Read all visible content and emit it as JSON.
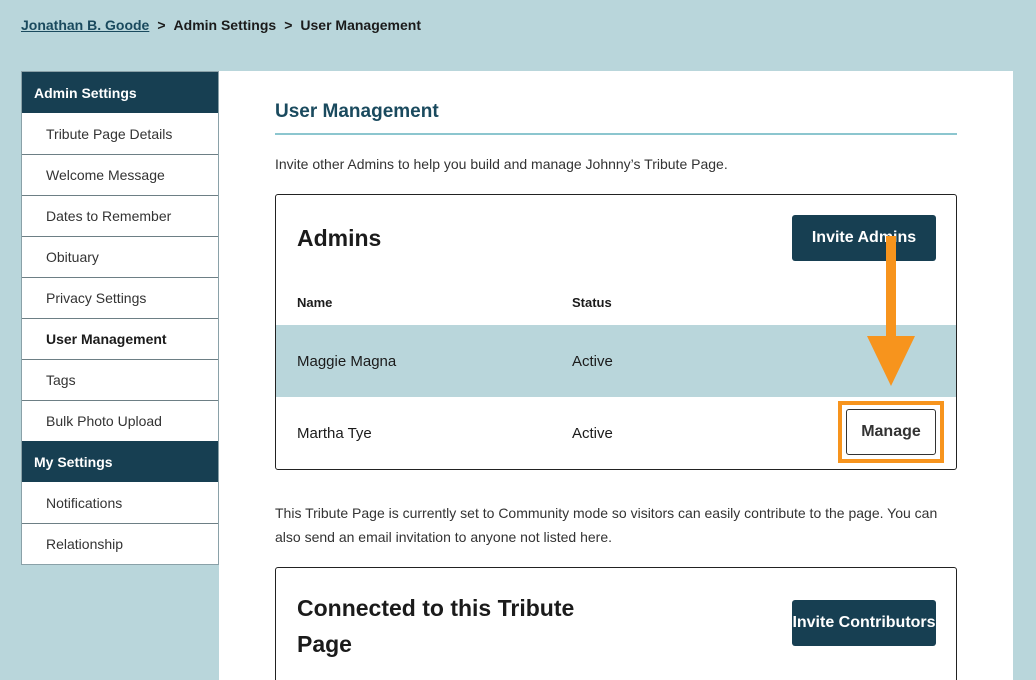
{
  "breadcrumb": {
    "user": "Jonathan B. Goode",
    "sep1": ">",
    "section": "Admin Settings",
    "sep2": ">",
    "current": "User Management"
  },
  "sidebar": {
    "admin_header": "Admin Settings",
    "admin_items": [
      {
        "label": "Tribute Page Details"
      },
      {
        "label": "Welcome Message"
      },
      {
        "label": "Dates to Remember"
      },
      {
        "label": "Obituary"
      },
      {
        "label": "Privacy Settings"
      },
      {
        "label": "User Management"
      },
      {
        "label": "Tags"
      },
      {
        "label": "Bulk Photo Upload"
      }
    ],
    "my_header": "My Settings",
    "my_items": [
      {
        "label": "Notifications"
      },
      {
        "label": "Relationship"
      }
    ]
  },
  "main": {
    "title": "User Management",
    "intro": "Invite other Admins to help you build and manage Johnny’s Tribute Page.",
    "admins": {
      "title": "Admins",
      "invite_label": "Invite Admins",
      "col_name": "Name",
      "col_status": "Status",
      "rows": [
        {
          "name": "Maggie Magna",
          "status": "Active"
        },
        {
          "name": "Martha Tye",
          "status": "Active",
          "action": "Manage"
        }
      ]
    },
    "community_text": "This Tribute Page is currently set to Community mode so visitors can easily contribute to the page. You can also send an email invitation to anyone not listed here.",
    "connected": {
      "title": "Connected to this Tribute Page",
      "invite_label": "Invite Contributors"
    }
  },
  "colors": {
    "background": "#b9d6db",
    "dark_accent": "#173f52",
    "highlight_border": "#f7941d",
    "arrow": "#f7941d"
  },
  "icons": {
    "annotation": "arrow-down-icon"
  }
}
